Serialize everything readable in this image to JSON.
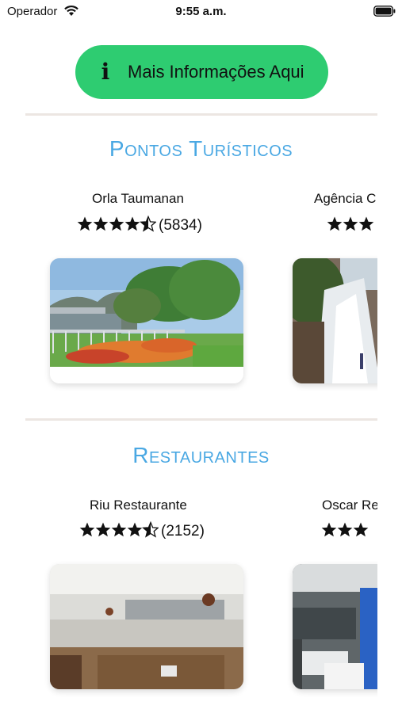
{
  "status_bar": {
    "carrier": "Operador",
    "time": "9:55 a.m."
  },
  "info_button": {
    "icon": "info-icon",
    "label": "Mais Informações Aqui"
  },
  "sections": [
    {
      "title": "Pontos Turísticos",
      "cards": [
        {
          "name": "Orla Taumanan",
          "rating": 4.5,
          "count": "(5834)",
          "image": "riverside-garden-photo"
        },
        {
          "name": "Agência C",
          "rating": 3,
          "count": "",
          "image": "waterfall-photo"
        }
      ]
    },
    {
      "title": "Restaurantes",
      "cards": [
        {
          "name": "Riu Restaurante",
          "rating": 4.5,
          "count": "(2152)",
          "image": "restaurant-interior-photo"
        },
        {
          "name": "Oscar Re",
          "rating": 3,
          "count": "",
          "image": "restaurant-hall-photo"
        }
      ]
    }
  ],
  "colors": {
    "accent_button": "#2ecc71",
    "section_title": "#4aa8e3",
    "divider": "#ece6e2"
  }
}
